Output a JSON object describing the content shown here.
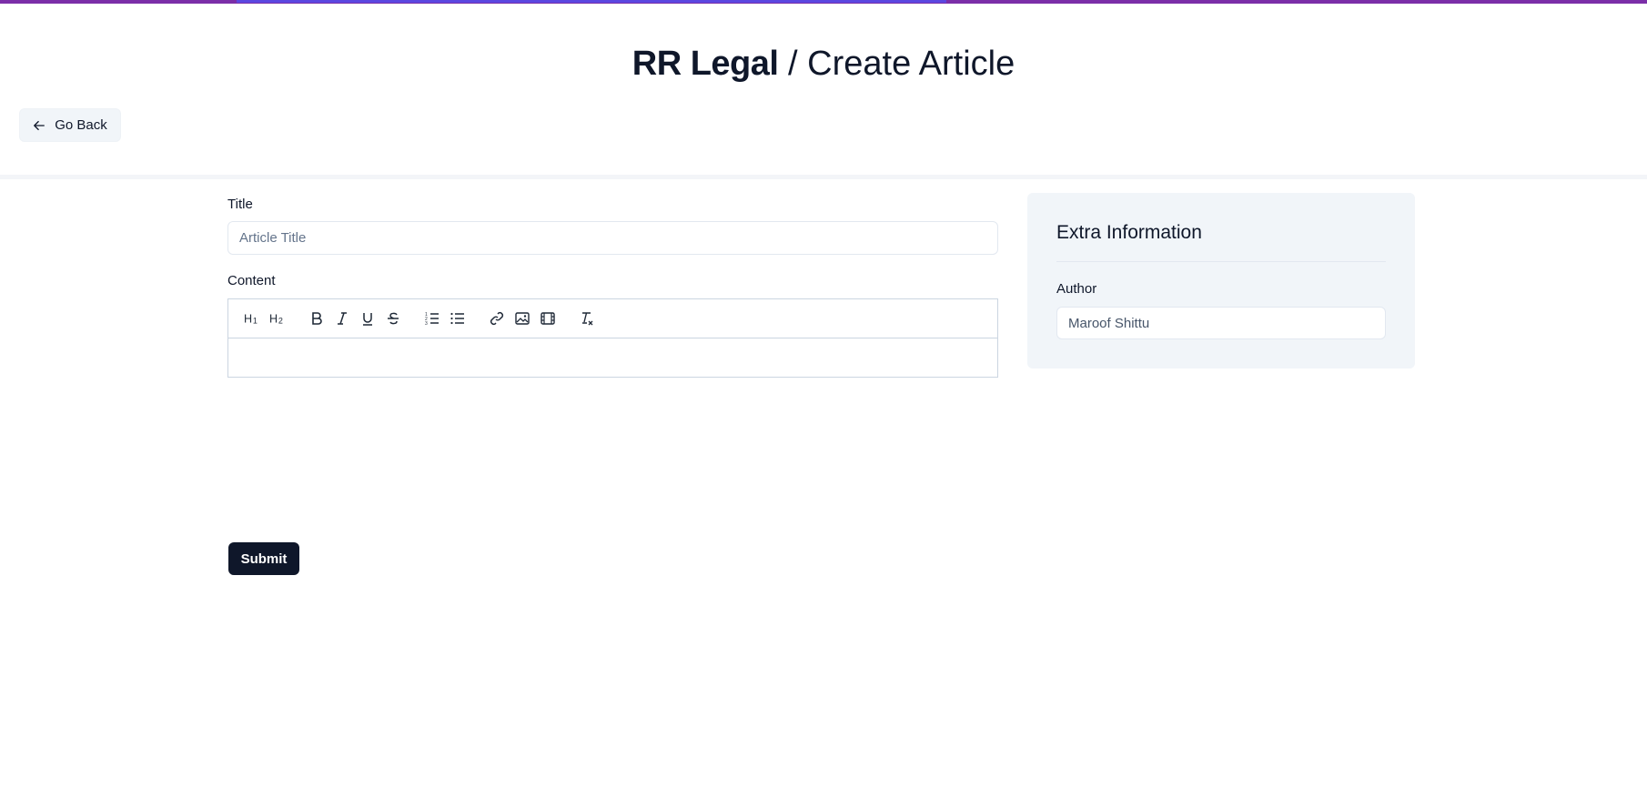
{
  "top_progress": {
    "value": 0.5,
    "color": "#5b47e0",
    "bar_color": "#7b2ea8"
  },
  "header": {
    "brand": "RR Legal",
    "separator": "/",
    "subtitle": "Create Article",
    "back_button": {
      "label": "Go Back",
      "icon": "arrow-left-icon"
    }
  },
  "form": {
    "title_label": "Title",
    "title_placeholder": "Article Title",
    "title_value": "",
    "content_label": "Content",
    "toolbar": [
      {
        "name": "heading-1-icon",
        "text": "H1"
      },
      {
        "name": "heading-2-icon",
        "text": "H2"
      },
      {
        "name": "bold-icon",
        "text": "B"
      },
      {
        "name": "italic-icon",
        "text": "I"
      },
      {
        "name": "underline-icon",
        "text": "U"
      },
      {
        "name": "strikethrough-icon",
        "text": "S"
      },
      {
        "name": "ordered-list-icon"
      },
      {
        "name": "bullet-list-icon"
      },
      {
        "name": "link-icon"
      },
      {
        "name": "image-icon"
      },
      {
        "name": "video-icon"
      },
      {
        "name": "clear-format-icon"
      }
    ],
    "content_value": "",
    "submit_label": "Submit"
  },
  "sidebar": {
    "heading": "Extra Information",
    "author_label": "Author",
    "author_value": "Maroof Shittu"
  },
  "colors": {
    "primary": "#0f172a",
    "panel": "#f1f5f9",
    "top_bar": "#7b2ea8"
  }
}
